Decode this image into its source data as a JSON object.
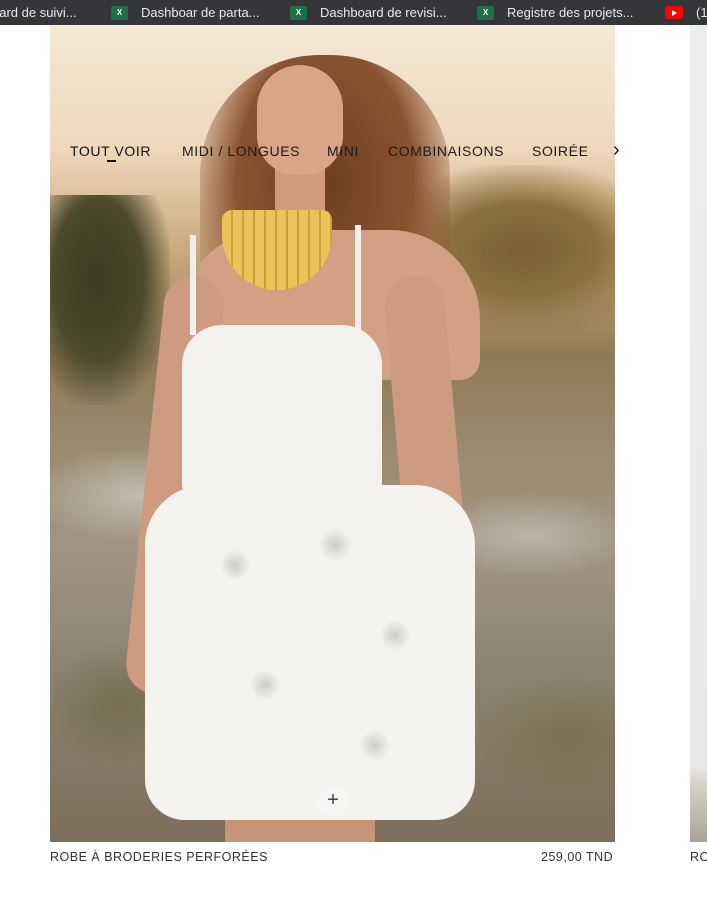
{
  "bookmarks": [
    {
      "label": "oard de suivi...",
      "icon": "excel-icon"
    },
    {
      "label": "Dashboar de parta...",
      "icon": "excel-icon"
    },
    {
      "label": "Dashboard de revisi...",
      "icon": "excel-icon"
    },
    {
      "label": "Registre des projets...",
      "icon": "excel-icon"
    },
    {
      "label": "(1",
      "icon": "youtube-icon"
    }
  ],
  "category_tabs": [
    {
      "label": "TOUT VOIR",
      "active": true
    },
    {
      "label": "MIDI / LONGUES",
      "active": false
    },
    {
      "label": "MINI",
      "active": false
    },
    {
      "label": "COMBINAISONS",
      "active": false
    },
    {
      "label": "SOIRÉE",
      "active": false
    }
  ],
  "tabs_next_icon": "chevron-right-icon",
  "product": {
    "name": "ROBE À BRODERIES PERFORÉES",
    "price": "259,00 TND",
    "quick_add_icon": "plus-icon"
  },
  "next_product": {
    "name_fragment": "RO"
  },
  "colors": {
    "bookmark_bar": "#35363a",
    "excel": "#1e7145",
    "youtube": "#ff0000",
    "text": "#1a1a1a"
  }
}
